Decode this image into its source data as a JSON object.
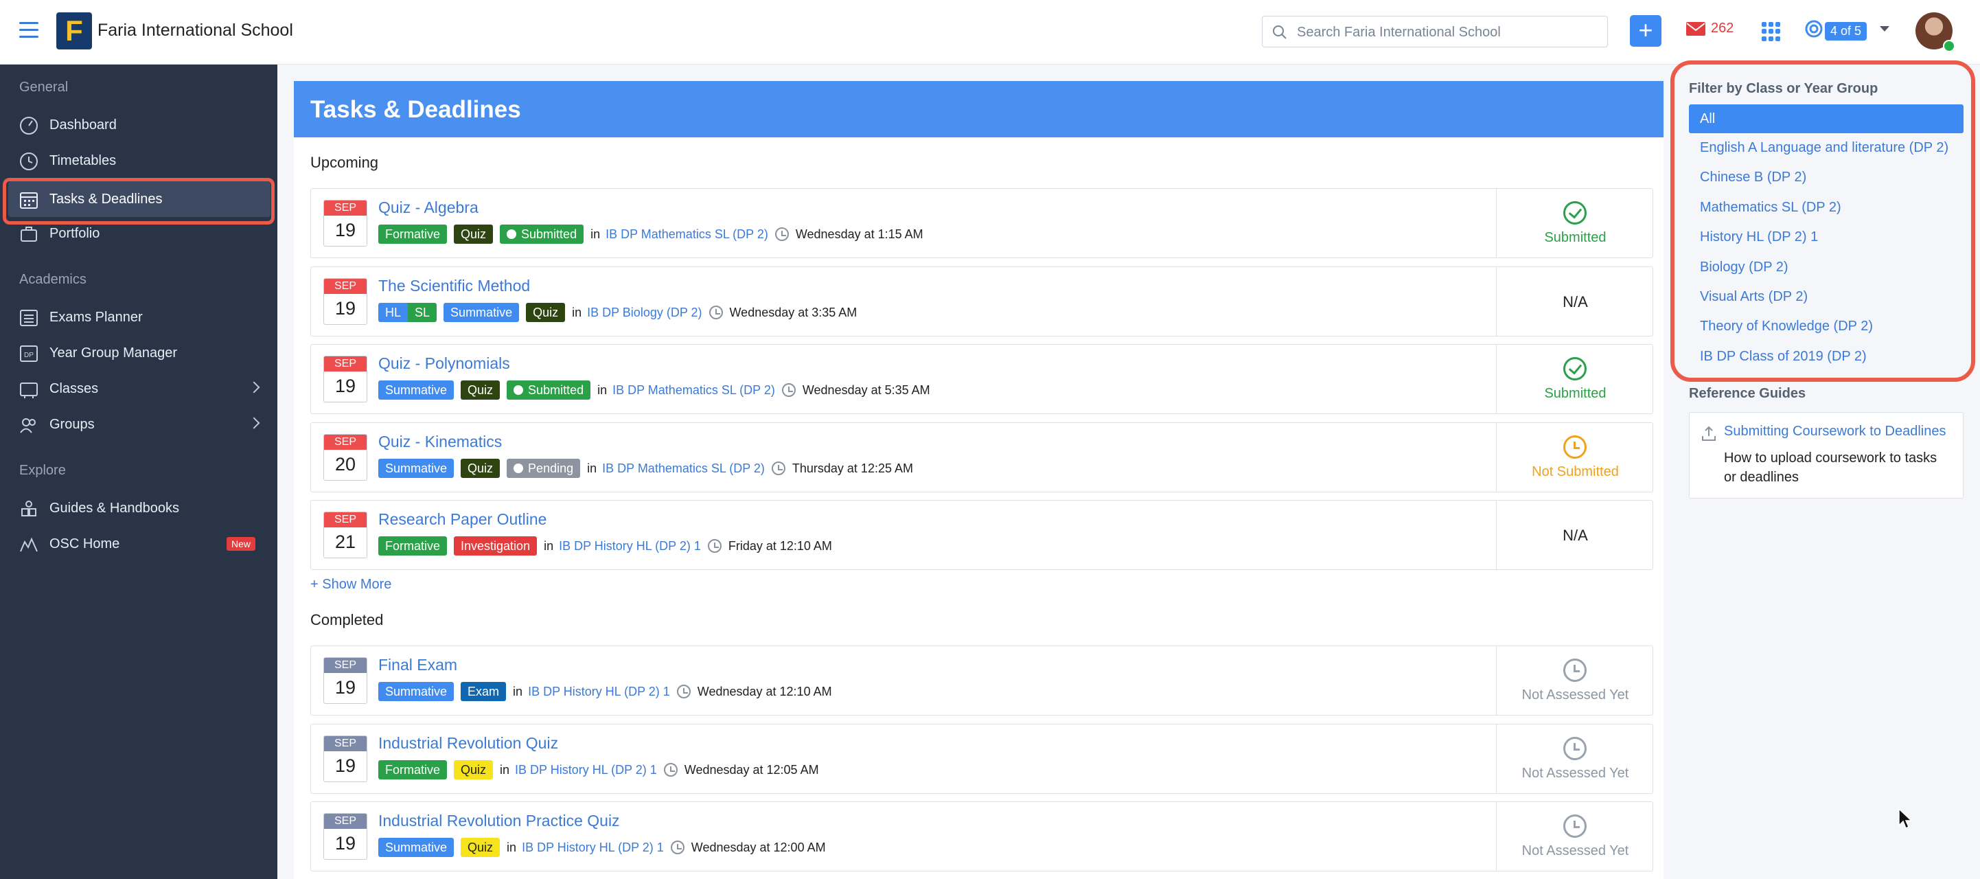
{
  "app": {
    "title": "Faria International School"
  },
  "search": {
    "placeholder": "Search Faria International School"
  },
  "header": {
    "add_label": "+",
    "mail_count": "262",
    "page_indicator": "4 of 5"
  },
  "sidebar": {
    "sections": [
      {
        "label": "General",
        "items": [
          {
            "label": "Dashboard",
            "icon": "dashboard-icon"
          },
          {
            "label": "Timetables",
            "icon": "clock-icon"
          },
          {
            "label": "Tasks & Deadlines",
            "icon": "calendar-icon",
            "active": true
          },
          {
            "label": "Portfolio",
            "icon": "portfolio-icon"
          }
        ]
      },
      {
        "label": "Academics",
        "items": [
          {
            "label": "Exams Planner",
            "icon": "list-icon"
          },
          {
            "label": "Year Group Manager",
            "icon": "dp-icon"
          },
          {
            "label": "Classes",
            "icon": "classes-icon"
          },
          {
            "label": "Groups",
            "icon": "groups-icon"
          }
        ]
      },
      {
        "label": "Explore",
        "items": [
          {
            "label": "Guides & Handbooks",
            "icon": "guides-icon"
          },
          {
            "label": "OSC Home",
            "icon": "osc-icon",
            "badge": "New"
          }
        ]
      }
    ]
  },
  "main": {
    "title": "Tasks & Deadlines",
    "upcoming_label": "Upcoming",
    "show_more": "+ Show More",
    "completed_label": "Completed",
    "in_text": "in",
    "upcoming": [
      {
        "month": "SEP",
        "day": "19",
        "title": "Quiz - Algebra",
        "tags": [
          "Formative",
          "Quiz",
          "Submitted"
        ],
        "class": "IB DP Mathematics SL (DP 2)",
        "time": "Wednesday at 1:15 AM",
        "status": "Submitted"
      },
      {
        "month": "SEP",
        "day": "19",
        "title": "The Scientific Method",
        "tags": [
          "HL",
          "SL",
          "Summative",
          "Quiz"
        ],
        "class": "IB DP Biology (DP 2)",
        "time": "Wednesday at 3:35 AM",
        "status": "N/A"
      },
      {
        "month": "SEP",
        "day": "19",
        "title": "Quiz - Polynomials",
        "tags": [
          "Summative",
          "Quiz",
          "Submitted"
        ],
        "class": "IB DP Mathematics SL (DP 2)",
        "time": "Wednesday at 5:35 AM",
        "status": "Submitted"
      },
      {
        "month": "SEP",
        "day": "20",
        "title": "Quiz - Kinematics",
        "tags": [
          "Summative",
          "Quiz",
          "Pending"
        ],
        "class": "IB DP Mathematics SL (DP 2)",
        "time": "Thursday at 12:25 AM",
        "status": "Not Submitted"
      },
      {
        "month": "SEP",
        "day": "21",
        "title": "Research Paper Outline",
        "tags": [
          "Formative",
          "Investigation"
        ],
        "class": "IB DP History HL (DP 2) 1",
        "time": "Friday at 12:10 AM",
        "status": "N/A"
      }
    ],
    "completed": [
      {
        "month": "SEP",
        "day": "19",
        "title": "Final Exam",
        "tags": [
          "Summative",
          "Exam"
        ],
        "class": "IB DP History HL (DP 2) 1",
        "time": "Wednesday at 12:10 AM",
        "status": "Not Assessed Yet"
      },
      {
        "month": "SEP",
        "day": "19",
        "title": "Industrial Revolution Quiz",
        "tags": [
          "Formative",
          "Quiz"
        ],
        "class": "IB DP History HL (DP 2) 1",
        "time": "Wednesday at 12:05 AM",
        "status": "Not Assessed Yet"
      },
      {
        "month": "SEP",
        "day": "19",
        "title": "Industrial Revolution Practice Quiz",
        "tags": [
          "Summative",
          "Quiz"
        ],
        "class": "IB DP History HL (DP 2) 1",
        "time": "Wednesday at 12:00 AM",
        "status": "Not Assessed Yet"
      }
    ]
  },
  "filter": {
    "title": "Filter by Class or Year Group",
    "options": [
      "All",
      "English A Language and literature (DP 2)",
      "Chinese B (DP 2)",
      "Mathematics SL (DP 2)",
      "History HL (DP 2) 1",
      "Biology (DP 2)",
      "Visual Arts (DP 2)",
      "Theory of Knowledge (DP 2)",
      "IB DP Class of 2019 (DP 2)"
    ],
    "selected": "All"
  },
  "reference": {
    "title": "Reference Guides",
    "link": "Submitting Coursework to Deadlines",
    "description": "How to upload coursework to tasks or deadlines"
  },
  "colors": {
    "accent": "#3d8bf2",
    "sidebar": "#2a3447",
    "highlight": "#ea5b4a",
    "formative": "#2aa048",
    "summative": "#3f8bef",
    "quiz": "#2e4512",
    "quiz_completed": "#f7e31b",
    "investigation": "#e43c3c",
    "exam": "#0f67b1",
    "pending": "#8d94a0",
    "status_submitted": "#2aa048",
    "status_not_submitted": "#f0a31a"
  }
}
